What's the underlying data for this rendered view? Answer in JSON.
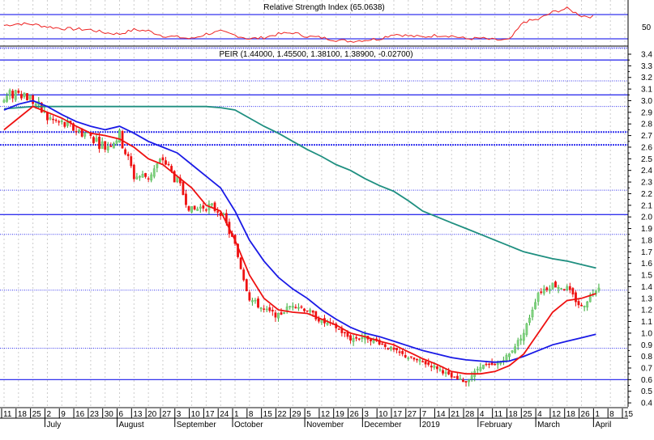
{
  "rsi_panel": {
    "title": "Relative Strength Index (65.0638)",
    "axis_label": "50"
  },
  "price_panel": {
    "title": "PEIR (1.44000, 1.45500, 1.38100, 1.38900, -0.02700)"
  },
  "colors": {
    "up": "#7fd17f",
    "down": "#ee1111",
    "ma_short": "#ee1111",
    "ma_mid": "#1a1ae6",
    "ma_long": "#1f8f80",
    "level": "#3333ee",
    "rsi": "#ee2222"
  },
  "chart_data": {
    "type": "candlestick",
    "y_ticks": [
      "3.4",
      "3.3",
      "3.2",
      "3.1",
      "3.0",
      "2.9",
      "2.8",
      "2.7",
      "2.6",
      "2.5",
      "2.4",
      "2.3",
      "2.2",
      "2.1",
      "2.0",
      "1.9",
      "1.8",
      "1.7",
      "1.6",
      "1.5",
      "1.4",
      "1.3",
      "1.2",
      "1.1",
      "1.0",
      "0.9",
      "0.8",
      "0.7",
      "0.6",
      "0.5",
      "0.4"
    ],
    "ylim": [
      0.4,
      3.4
    ],
    "week_labels": [
      "11",
      "18",
      "25",
      "2",
      "9",
      "16",
      "23",
      "30",
      "6",
      "13",
      "20",
      "27",
      "3",
      "10",
      "17",
      "24",
      "1",
      "8",
      "15",
      "22",
      "29",
      "5",
      "12",
      "19",
      "26",
      "3",
      "10",
      "17",
      "27",
      "7",
      "14",
      "21",
      "28",
      "4",
      "11",
      "18",
      "25",
      "4",
      "12",
      "18",
      "26",
      "1",
      "8",
      "15"
    ],
    "month_labels": [
      {
        "label": "July",
        "week": 3
      },
      {
        "label": "August",
        "week": 8
      },
      {
        "label": "September",
        "week": 12
      },
      {
        "label": "October",
        "week": 16
      },
      {
        "label": "November",
        "week": 21
      },
      {
        "label": "December",
        "week": 25
      },
      {
        "label": "2019",
        "week": 29
      },
      {
        "label": "February",
        "week": 33
      },
      {
        "label": "March",
        "week": 37
      },
      {
        "label": "April",
        "week": 41
      }
    ],
    "weekly_close": [
      3.0,
      3.1,
      3.0,
      2.85,
      2.8,
      2.75,
      2.7,
      2.6,
      2.7,
      2.35,
      2.35,
      2.5,
      2.3,
      2.05,
      2.1,
      2.05,
      1.75,
      1.3,
      1.2,
      1.15,
      1.25,
      1.2,
      1.1,
      1.05,
      0.95,
      0.97,
      0.92,
      0.85,
      0.79,
      0.75,
      0.7,
      0.62,
      0.58,
      0.72,
      0.72,
      0.82,
      1.0,
      1.35,
      1.42,
      1.38,
      1.22,
      1.389
    ],
    "ma_short": [
      2.75,
      2.85,
      2.95,
      2.9,
      2.85,
      2.78,
      2.72,
      2.7,
      2.67,
      2.6,
      2.5,
      2.45,
      2.35,
      2.25,
      2.1,
      2.05,
      1.8,
      1.5,
      1.3,
      1.2,
      1.18,
      1.17,
      1.12,
      1.07,
      1.0,
      0.97,
      0.93,
      0.9,
      0.84,
      0.78,
      0.73,
      0.67,
      0.65,
      0.65,
      0.67,
      0.72,
      0.82,
      1.0,
      1.18,
      1.28,
      1.3,
      1.34
    ],
    "ma_mid": [
      2.92,
      2.97,
      3.0,
      2.95,
      2.88,
      2.82,
      2.78,
      2.75,
      2.78,
      2.72,
      2.65,
      2.6,
      2.55,
      2.45,
      2.35,
      2.25,
      2.05,
      1.8,
      1.62,
      1.48,
      1.38,
      1.3,
      1.2,
      1.12,
      1.05,
      1.0,
      0.97,
      0.93,
      0.89,
      0.85,
      0.82,
      0.79,
      0.77,
      0.76,
      0.75,
      0.76,
      0.8,
      0.85,
      0.9,
      0.93,
      0.96,
      0.99
    ],
    "ma_long": [
      2.93,
      2.94,
      2.95,
      2.95,
      2.95,
      2.95,
      2.95,
      2.95,
      2.95,
      2.95,
      2.95,
      2.95,
      2.95,
      2.95,
      2.95,
      2.94,
      2.92,
      2.85,
      2.78,
      2.72,
      2.65,
      2.58,
      2.52,
      2.45,
      2.4,
      2.33,
      2.27,
      2.22,
      2.14,
      2.05,
      2.0,
      1.95,
      1.9,
      1.85,
      1.8,
      1.75,
      1.7,
      1.67,
      1.64,
      1.62,
      1.59,
      1.56
    ],
    "rsi": [
      52,
      55,
      54,
      50,
      47,
      46,
      45,
      40,
      38,
      45,
      43,
      35,
      33,
      30,
      38,
      42,
      36,
      30,
      32,
      38,
      40,
      34,
      32,
      28,
      26,
      28,
      30,
      38,
      35,
      33,
      36,
      35,
      30,
      31,
      28,
      28,
      58,
      62,
      74,
      80,
      68,
      66
    ],
    "rsi_levels": [
      70,
      30
    ],
    "levels_solid": [
      3.35,
      3.05,
      2.02,
      0.6
    ],
    "levels_dotted": [
      3.45,
      3.17,
      2.95,
      2.23,
      1.85,
      1.37,
      0.87
    ],
    "levels_thick_dotted": [
      2.73,
      2.62
    ]
  }
}
